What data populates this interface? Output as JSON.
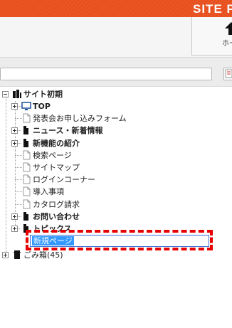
{
  "header": {
    "site_title": "SITE P",
    "brand_color": "#e8501e"
  },
  "toolbar": {
    "home_label": "ホー",
    "home_icon": "up-arrow-home-icon"
  },
  "filter": {
    "search_value": "",
    "search_icon": "search-icon"
  },
  "tree": {
    "root": {
      "label": "サイト初期",
      "icon": "site-root-icon"
    },
    "nodes": [
      {
        "label": "TOP",
        "bold": true,
        "expandable": true,
        "icon": "monitor-icon"
      },
      {
        "label": "発表会お申し込みフォーム",
        "bold": false,
        "expandable": false,
        "icon": "page-icon"
      },
      {
        "label": "ニュース・新着情報",
        "bold": true,
        "expandable": true,
        "icon": "folder-icon"
      },
      {
        "label": "新機能の紹介",
        "bold": true,
        "expandable": true,
        "icon": "folder-icon"
      },
      {
        "label": "検索ページ",
        "bold": false,
        "expandable": false,
        "icon": "page-icon"
      },
      {
        "label": "サイトマップ",
        "bold": false,
        "expandable": false,
        "icon": "page-icon"
      },
      {
        "label": "ログインコーナー",
        "bold": false,
        "expandable": false,
        "icon": "page-icon"
      },
      {
        "label": "導入事項",
        "bold": false,
        "expandable": false,
        "icon": "page-icon"
      },
      {
        "label": "カタログ請求",
        "bold": false,
        "expandable": false,
        "icon": "page-icon"
      },
      {
        "label": "お問い合わせ",
        "bold": true,
        "expandable": true,
        "icon": "folder-icon"
      },
      {
        "label": "トピックス",
        "bold": true,
        "expandable": true,
        "icon": "folder-icon"
      }
    ],
    "editing": {
      "value": "新規ページ",
      "highlight_color": "#e60000"
    },
    "trash": {
      "label": "ごみ箱(45)",
      "icon": "trash-icon"
    }
  }
}
